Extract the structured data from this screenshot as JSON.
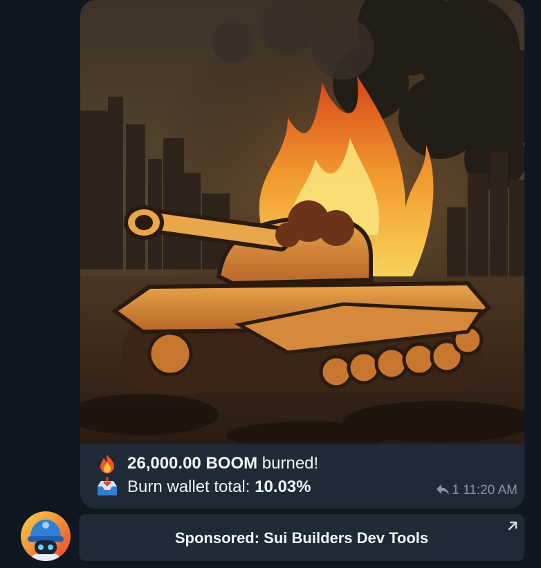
{
  "message": {
    "line1": {
      "emoji": "fire-icon",
      "amount": "26,000.00 BOOM",
      "suffix": " burned!"
    },
    "line2": {
      "emoji": "inbox-tray-icon",
      "label": "Burn wallet total: ",
      "value": "10.03%"
    },
    "reply_count": "1",
    "timestamp": "11:20 AM"
  },
  "sponsored": {
    "label": "Sponsored: Sui Builders Dev Tools"
  },
  "colors": {
    "background": "#0f1720",
    "bubble": "#1f2a37",
    "text": "#f2f5f8",
    "meta": "#8a96a6"
  }
}
